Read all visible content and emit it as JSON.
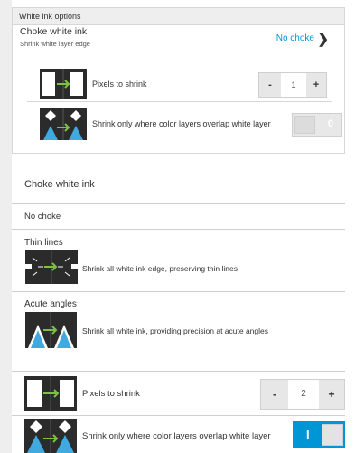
{
  "panel": {
    "header": "White ink options",
    "choke": {
      "title": "Choke white ink",
      "subtitle": "Shrink white layer edge",
      "value": "No choke"
    },
    "pixels": {
      "label": "Pixels to shrink",
      "value": "1",
      "minus": "-",
      "plus": "+"
    },
    "overlap": {
      "label": "Shrink only where color layers overlap white layer",
      "toggle_text": "0"
    }
  },
  "choke_section": {
    "title": "Choke white ink",
    "no_choke": "No choke",
    "thin_lines": {
      "title": "Thin lines",
      "desc": "Shrink all white ink edge, preserving thin lines"
    },
    "acute_angles": {
      "title": "Acute angles",
      "desc": "Shrink all white ink, providing precision at acute angles"
    }
  },
  "bottom": {
    "pixels": {
      "label": "Pixels to shrink",
      "value": "2",
      "minus": "-",
      "plus": "+"
    },
    "overlap": {
      "label": "Shrink only where color layers overlap white layer",
      "toggle_text": "I"
    }
  },
  "colors": {
    "accent": "#0096d6",
    "arrow": "#7cc242",
    "thumb_bg": "#2b2b2b",
    "triangle": "#3fa9e0"
  }
}
